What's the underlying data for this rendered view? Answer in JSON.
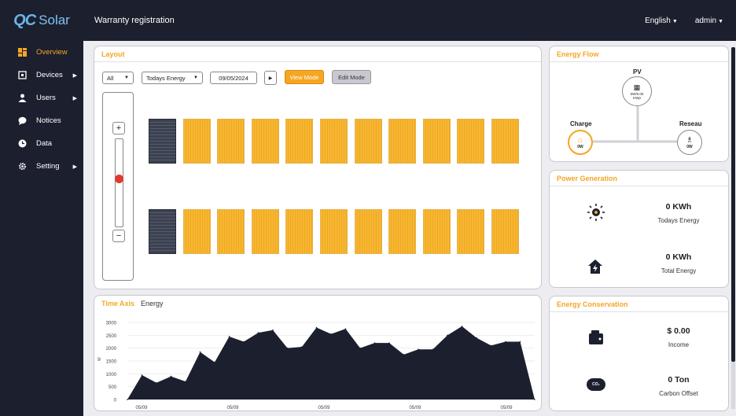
{
  "app": {
    "logo_mark": "QC",
    "logo_word": "Solar",
    "title": "Warranty registration",
    "language": "English",
    "user": "admin"
  },
  "sidebar": {
    "items": [
      {
        "label": "Overview",
        "active": true,
        "icon": "dashboard-icon"
      },
      {
        "label": "Devices",
        "icon": "devices-icon",
        "has_arrow": true
      },
      {
        "label": "Users",
        "icon": "user-icon",
        "has_arrow": true
      },
      {
        "label": "Notices",
        "icon": "chat-icon"
      },
      {
        "label": "Data",
        "icon": "clock-icon"
      },
      {
        "label": "Setting",
        "icon": "gear-icon",
        "has_arrow": true
      }
    ]
  },
  "layout": {
    "title": "Layout",
    "filter_all": "All",
    "metric": "Todays Energy",
    "date": "09/05/2024",
    "view_mode": "View Mode",
    "edit_mode": "Edit Mode",
    "zoom_level": 0.55
  },
  "time_axis": {
    "title": "Time Axis",
    "tab": "Energy"
  },
  "energy_flow": {
    "title": "Energy Flow",
    "pv_label": "PV",
    "pv_values": "0W/5.00\nKWp",
    "charge_label": "Charge",
    "charge_value": "0W",
    "reseau_label": "Reseau",
    "reseau_value": "0W"
  },
  "power_generation": {
    "title": "Power Generation",
    "todays_value": "0 KWh",
    "todays_label": "Todays Energy",
    "total_value": "0 KWh",
    "total_label": "Total Energy"
  },
  "energy_conservation": {
    "title": "Energy Conservation",
    "income_value": "$ 0.00",
    "income_label": "Income",
    "carbon_value": "0 Ton",
    "carbon_label": "Carbon Offset",
    "co2_icon_text": "CO₂"
  },
  "colors": {
    "accent": "#f5a623",
    "sidebar": "#1c1f2e",
    "edit_button": "#c8c8d0"
  },
  "chart_data": {
    "type": "area",
    "title": "",
    "ylabel": "W",
    "ylim": [
      0,
      3000
    ],
    "yticks": [
      "3000",
      "2500",
      "2000",
      "1500",
      "1000",
      "500",
      "0"
    ],
    "xtick_labels": [
      "05/09",
      "05/09",
      "05/09",
      "05/09",
      "05/09"
    ],
    "values": [
      0,
      950,
      650,
      900,
      700,
      1850,
      1450,
      2450,
      2250,
      2600,
      2700,
      2000,
      2050,
      2800,
      2550,
      2750,
      2000,
      2200,
      2200,
      1750,
      1950,
      1950,
      2500,
      2850,
      2400,
      2100,
      2250,
      2250,
      0
    ]
  }
}
